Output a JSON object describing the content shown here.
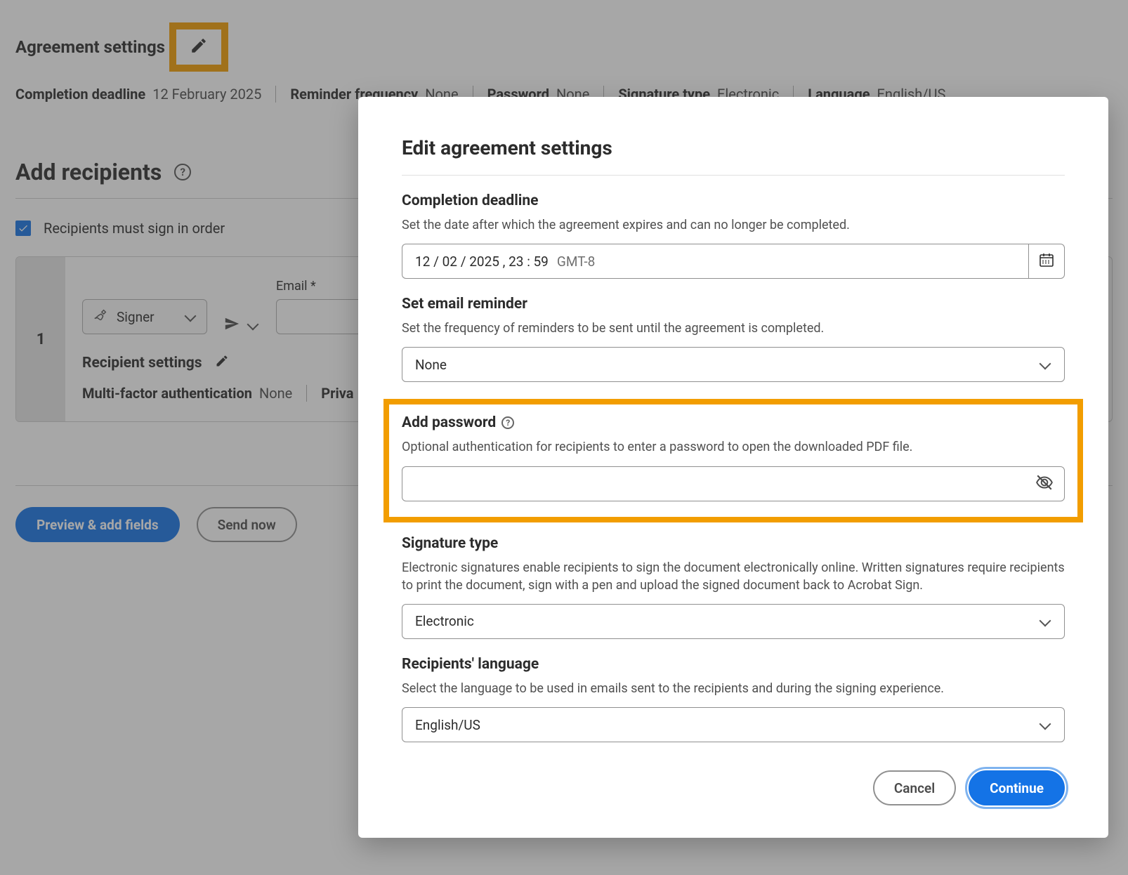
{
  "page": {
    "settings_title": "Agreement settings",
    "summary": {
      "deadline_label": "Completion deadline",
      "deadline_value": "12 February 2025",
      "reminder_label": "Reminder frequency",
      "reminder_value": "None",
      "password_label": "Password",
      "password_value": "None",
      "sigtype_label": "Signature type",
      "sigtype_value": "Electronic",
      "language_label": "Language",
      "language_value": "English/US"
    },
    "recipients_heading": "Add recipients",
    "sign_order_label": "Recipients must sign in order",
    "recipient": {
      "index": "1",
      "role": "Signer",
      "email_label": "Email  *",
      "settings_label": "Recipient settings",
      "mfa_label": "Multi-factor authentication",
      "mfa_value": "None",
      "private_label": "Priva"
    },
    "preview_btn": "Preview & add fields",
    "send_btn": "Send now"
  },
  "dialog": {
    "title": "Edit agreement settings",
    "deadline": {
      "label": "Completion deadline",
      "desc": "Set the date after which the agreement expires and can no longer be completed.",
      "value": "12 /   02 /  2025 ,   23 : 59",
      "tz": "GMT-8"
    },
    "reminder": {
      "label": "Set email reminder",
      "desc": "Set the frequency of reminders to be sent until the agreement is completed.",
      "value": "None"
    },
    "password": {
      "label": "Add password",
      "desc": "Optional authentication for recipients to enter a password to open the downloaded PDF file."
    },
    "sigtype": {
      "label": "Signature type",
      "desc": "Electronic signatures enable recipients to sign the document electronically online. Written signatures require recipients to print the document, sign with a pen and upload the signed document back to Acrobat Sign.",
      "value": "Electronic"
    },
    "language": {
      "label": "Recipients' language",
      "desc": "Select the language to be used in emails sent to the recipients and during the signing experience.",
      "value": "English/US"
    },
    "cancel": "Cancel",
    "continue": "Continue"
  }
}
